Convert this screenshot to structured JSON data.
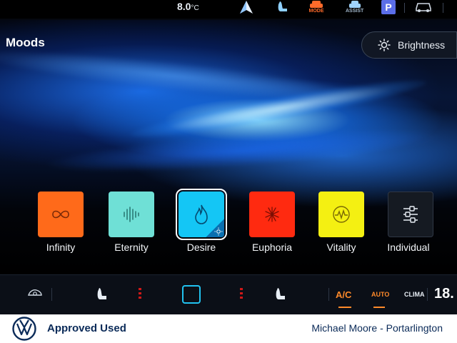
{
  "status_bar": {
    "temperature": "8.0",
    "temperature_unit": "°C",
    "mode_label": "MODE",
    "assist_label": "ASSIST",
    "parking_label": "P"
  },
  "moods": {
    "title": "Moods",
    "brightness_label": "Brightness",
    "items": [
      {
        "label": "Infinity",
        "color": "#ff6a1a",
        "icon": "infinity-icon"
      },
      {
        "label": "Eternity",
        "color": "#6fe0d6",
        "icon": "soundwave-icon"
      },
      {
        "label": "Desire",
        "color": "#14c6f5",
        "icon": "flame-icon",
        "selected": true
      },
      {
        "label": "Euphoria",
        "color": "#ff2a10",
        "icon": "sparkle-icon"
      },
      {
        "label": "Vitality",
        "color": "#f4f012",
        "icon": "pulse-icon"
      },
      {
        "label": "Individual",
        "color": "#151a22",
        "icon": "sliders-icon"
      }
    ]
  },
  "climate": {
    "ac_label": "A/C",
    "auto_label": "AUTO",
    "clima_label": "CLIMA",
    "right_temp": "18."
  },
  "footer": {
    "approved_label": "Approved Used",
    "dealer": "Michael Moore - Portarlington"
  },
  "colors": {
    "accent_orange": "#ff8a2a",
    "brand_blue": "#0a2a58"
  }
}
